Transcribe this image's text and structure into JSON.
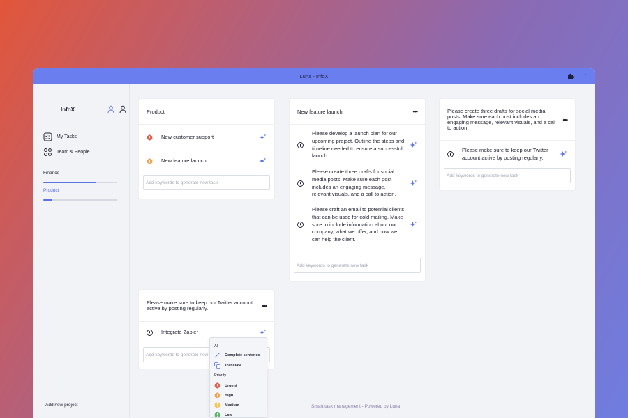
{
  "window": {
    "title": "Luna - InfoX",
    "extension_icon": "puzzle-icon",
    "more_icon": "more-vertical-icon"
  },
  "sidebar": {
    "brand": "InfoX",
    "nav": [
      {
        "label": "My Tasks",
        "icon": "tasks-icon"
      },
      {
        "label": "Team & People",
        "icon": "team-icon"
      }
    ],
    "projects": [
      {
        "label": "Finance",
        "progress": 0.72,
        "color": "#1d1f2c"
      },
      {
        "label": "Product",
        "progress": 0.12,
        "color": "#5d73e3"
      }
    ],
    "add_project": "Add new project"
  },
  "cards": {
    "product": {
      "title": "Product",
      "tasks": [
        {
          "text": "New customer support",
          "priority": "urgent"
        },
        {
          "text": "New feature launch",
          "priority": "high"
        }
      ],
      "input_placeholder": "Add keywords to generate new task"
    },
    "feature": {
      "title": "New feature launch",
      "tasks": [
        {
          "text": "Please develop a launch plan for our upcoming project. Outline the steps and timeline needed to ensure a successful launch."
        },
        {
          "text": "Please create three drafts for social media posts. Make sure each post includes an engaging message, relevant visuals, and a call to action."
        },
        {
          "text": "Please craft an email to potential clients that can be used for cold mailing. Make sure to include information about our company, what we offer, and how we can help the client."
        }
      ],
      "input_placeholder": "Add keywords to generate new task"
    },
    "social": {
      "title": "Please create three drafts for social media posts. Make sure each post includes an engaging message, relevant visuals, and a call to action.",
      "tasks": [
        {
          "text": "Please make sure to keep our Twitter account active by posting regularly."
        }
      ],
      "input_placeholder": "Add keywords to generate new task"
    },
    "twitter": {
      "title": "Please make sure to keep our Twitter account active by posting regularly.",
      "tasks": [
        {
          "text": "Integrate Zapier"
        }
      ],
      "input_placeholder": "Add keywords to generate new task"
    }
  },
  "menu": {
    "ai_label": "AI",
    "ai_items": [
      "Complete sentence",
      "Translate"
    ],
    "priority_label": "Priority",
    "priority_items": [
      "Urgent",
      "High",
      "Medium",
      "Low"
    ]
  },
  "footer": "Smart task management - Powered by Luna",
  "colors": {
    "accent": "#5d73e3",
    "urgent": "#e0614b",
    "high": "#f0a34a",
    "medium": "#f3c54a",
    "low": "#5fb36a"
  }
}
